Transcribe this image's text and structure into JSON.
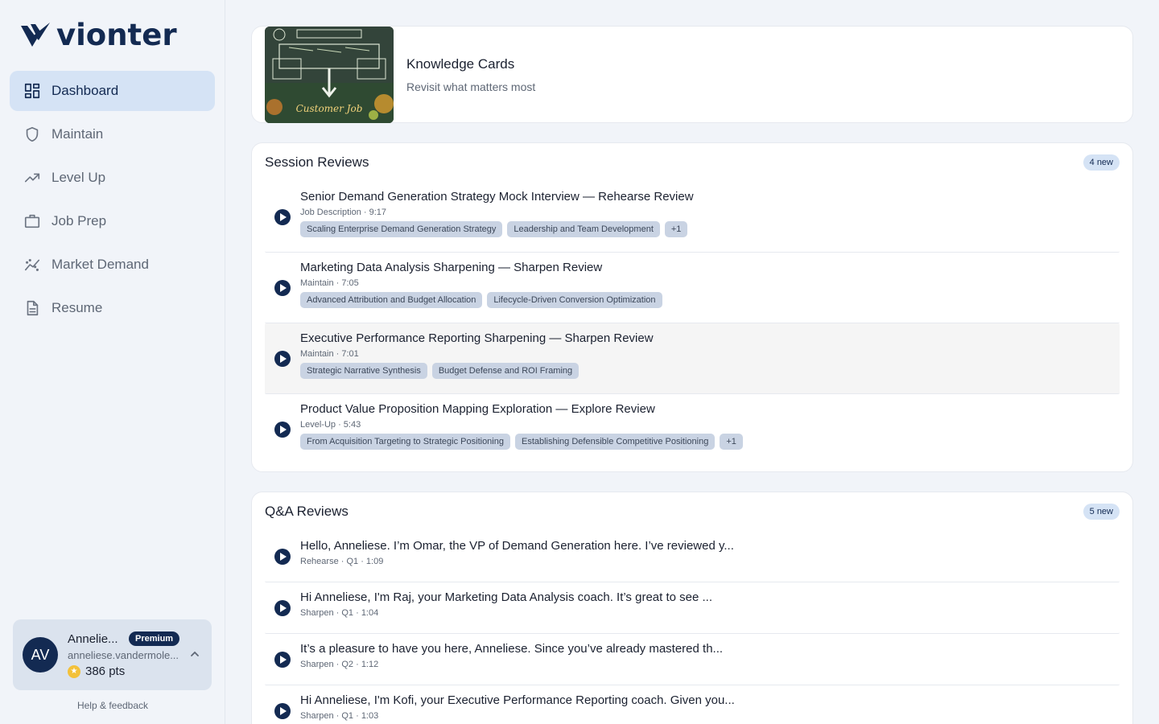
{
  "brand": {
    "name": "vionter"
  },
  "sidebar": {
    "items": [
      {
        "label": "Dashboard",
        "icon": "dashboard-icon",
        "active": true
      },
      {
        "label": "Maintain",
        "icon": "shield-icon"
      },
      {
        "label": "Level Up",
        "icon": "trending-up-icon"
      },
      {
        "label": "Job Prep",
        "icon": "briefcase-icon"
      },
      {
        "label": "Market Demand",
        "icon": "chart-scatter-icon"
      },
      {
        "label": "Resume",
        "icon": "document-icon"
      }
    ]
  },
  "user": {
    "initials": "AV",
    "name": "Annelie...",
    "plan": "Premium",
    "email": "anneliese.vandermole...",
    "points": "386 pts"
  },
  "help_label": "Help & feedback",
  "knowledge_cards": {
    "title": "Knowledge Cards",
    "subtitle": "Revisit what matters most",
    "thumb_caption": "Customer Job"
  },
  "session_reviews": {
    "title": "Session Reviews",
    "badge": "4 new",
    "items": [
      {
        "title": "Senior Demand Generation Strategy Mock Interview — Rehearse Review",
        "meta": "Job Description · 9:17",
        "tags": [
          "Scaling Enterprise Demand Generation Strategy",
          "Leadership and Team Development",
          "+1"
        ]
      },
      {
        "title": "Marketing Data Analysis Sharpening — Sharpen Review",
        "meta": "Maintain · 7:05",
        "tags": [
          "Advanced Attribution and Budget Allocation",
          "Lifecycle-Driven Conversion Optimization"
        ]
      },
      {
        "title": "Executive Performance Reporting Sharpening — Sharpen Review",
        "meta": "Maintain · 7:01",
        "tags": [
          "Strategic Narrative Synthesis",
          "Budget Defense and ROI Framing"
        ]
      },
      {
        "title": "Product Value Proposition Mapping Exploration — Explore Review",
        "meta": "Level-Up · 5:43",
        "tags": [
          "From Acquisition Targeting to Strategic Positioning",
          "Establishing Defensible Competitive Positioning",
          "+1"
        ]
      }
    ]
  },
  "qa_reviews": {
    "title": "Q&A Reviews",
    "badge": "5 new",
    "items": [
      {
        "title": "Hello, Anneliese. I’m Omar, the VP of Demand Generation here. I’ve reviewed y...",
        "meta": "Rehearse · Q1 · 1:09"
      },
      {
        "title": "Hi Anneliese, I'm Raj, your Marketing Data Analysis coach. It’s great to see ...",
        "meta": "Sharpen · Q1 · 1:04"
      },
      {
        "title": "It’s a pleasure to have you here, Anneliese. Since you’ve already mastered th...",
        "meta": "Sharpen · Q2 · 1:12"
      },
      {
        "title": "Hi Anneliese, I'm Kofi, your Executive Performance Reporting coach. Given you...",
        "meta": "Sharpen · Q1 · 1:03"
      }
    ]
  },
  "colors": {
    "brand": "#132a52",
    "active_bg": "#d5e3f5",
    "tag_bg": "#c9d3e3",
    "coin": "#f3c13a"
  }
}
